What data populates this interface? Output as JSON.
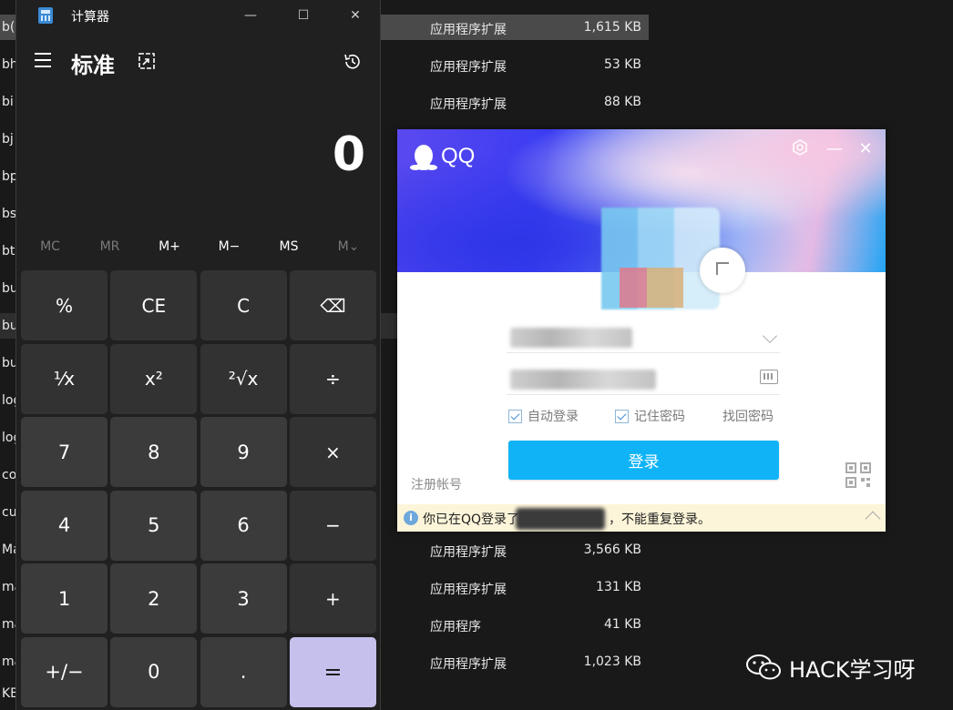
{
  "explorer": {
    "rows": [
      {
        "name": "b(",
        "type": "应用程序扩展",
        "size": "1,615 KB",
        "selected": true
      },
      {
        "name": "bh",
        "type": "应用程序扩展",
        "size": "53 KB"
      },
      {
        "name": "bi",
        "type": "应用程序扩展",
        "size": "88 KB"
      },
      {
        "name": "bj",
        "type": "",
        "size": ""
      },
      {
        "name": "bp",
        "type": "",
        "size": ""
      },
      {
        "name": "bs",
        "type": "",
        "size": ""
      },
      {
        "name": "bt",
        "type": "",
        "size": ""
      },
      {
        "name": "bu",
        "type": "",
        "size": ""
      },
      {
        "name": "bu",
        "type": "",
        "size": "",
        "hover": true
      },
      {
        "name": "bu",
        "type": "",
        "size": ""
      },
      {
        "name": "log",
        "type": "",
        "size": ""
      },
      {
        "name": "log",
        "type": "",
        "size": ""
      },
      {
        "name": "con",
        "type": "",
        "size": ""
      },
      {
        "name": "cua.",
        "type": "",
        "size": ""
      },
      {
        "name": "Ma",
        "type": "应用程序扩展",
        "size": "3,566 KB"
      },
      {
        "name": "ma.",
        "type": "应用程序扩展",
        "size": "131 KB"
      },
      {
        "name": "mal",
        "type": "应用程序",
        "size": "41 KB"
      },
      {
        "name": "mal",
        "type": "应用程序扩展",
        "size": "1,023 KB"
      },
      {
        "name": "KB",
        "type": "",
        "size": ""
      }
    ]
  },
  "calculator": {
    "title": "计算器",
    "mode": "标准",
    "display": "0",
    "memory": [
      "MC",
      "MR",
      "M+",
      "M−",
      "MS",
      "M⌄"
    ],
    "keys": [
      [
        "%",
        "CE",
        "C",
        "⌫"
      ],
      [
        "¹⁄x",
        "x²",
        "²√x",
        "÷"
      ],
      [
        "7",
        "8",
        "9",
        "×"
      ],
      [
        "4",
        "5",
        "6",
        "−"
      ],
      [
        "1",
        "2",
        "3",
        "+"
      ],
      [
        "+/−",
        "0",
        ".",
        "="
      ]
    ]
  },
  "qq": {
    "brand": "QQ",
    "auto_login": "自动登录",
    "remember_password": "记住密码",
    "recover_password": "找回密码",
    "login_button": "登录",
    "register": "注册帐号",
    "notice_prefix": "你已在QQ登录了",
    "notice_suffix": "，不能重复登录。",
    "accent_color": "#10b4f6"
  },
  "watermark": {
    "text": "HACK学习呀"
  }
}
